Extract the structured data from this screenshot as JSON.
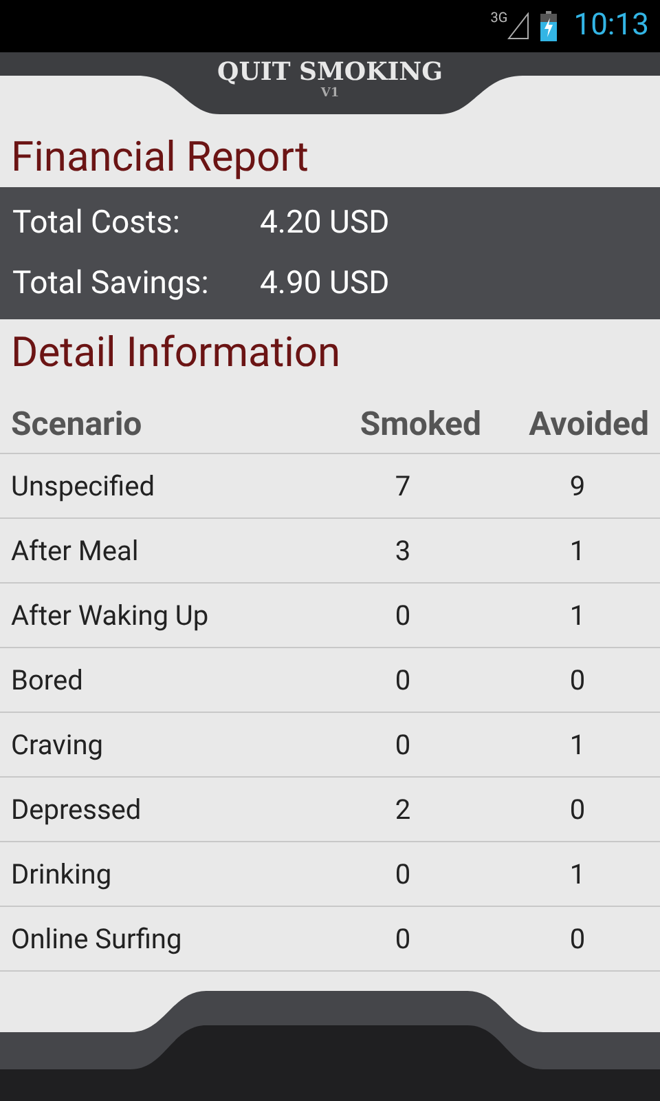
{
  "status_bar": {
    "network": "3G",
    "time": "10:13"
  },
  "header": {
    "title": "QUIT SMOKING",
    "version": "V1"
  },
  "financial_report": {
    "title": "Financial Report",
    "lines": [
      {
        "label": "Total Costs:",
        "value": "4.20 USD"
      },
      {
        "label": "Total Savings:",
        "value": "4.90 USD"
      }
    ]
  },
  "detail_information": {
    "title": "Detail Information",
    "columns": [
      "Scenario",
      "Smoked",
      "Avoided"
    ],
    "rows": [
      {
        "scenario": "Unspecified",
        "smoked": "7",
        "avoided": "9"
      },
      {
        "scenario": "After Meal",
        "smoked": "3",
        "avoided": "1"
      },
      {
        "scenario": "After Waking Up",
        "smoked": "0",
        "avoided": "1"
      },
      {
        "scenario": "Bored",
        "smoked": "0",
        "avoided": "0"
      },
      {
        "scenario": "Craving",
        "smoked": "0",
        "avoided": "1"
      },
      {
        "scenario": "Depressed",
        "smoked": "2",
        "avoided": "0"
      },
      {
        "scenario": "Drinking",
        "smoked": "0",
        "avoided": "1"
      },
      {
        "scenario": "Online Surfing",
        "smoked": "0",
        "avoided": "0"
      }
    ]
  }
}
